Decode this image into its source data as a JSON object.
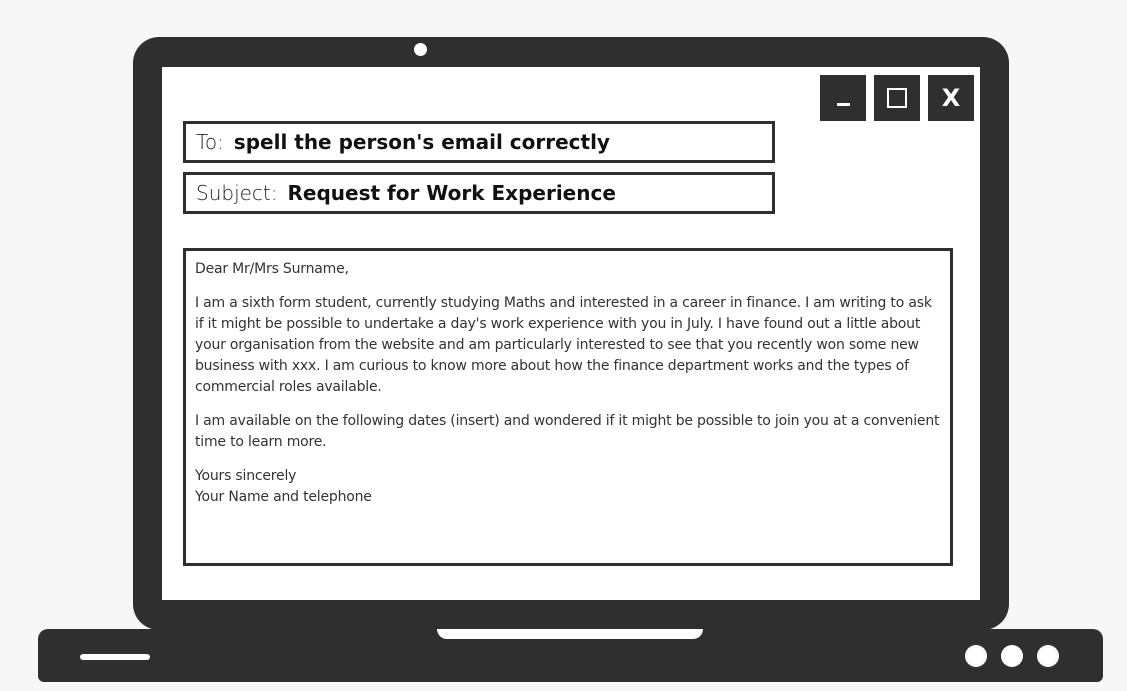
{
  "window_controls": {
    "minimize_icon": "minimize-icon",
    "maximize_icon": "maximize-icon",
    "close_label": "X"
  },
  "email": {
    "to_label": "To:",
    "to_value": "spell the person's email correctly",
    "subject_label": "Subject:",
    "subject_value": "Request for Work Experience",
    "body": {
      "greeting": "Dear Mr/Mrs Surname,",
      "paragraph1": "I am a sixth form student, currently studying Maths and interested in a career in finance.  I am writing to ask if it might be possible to undertake a day's work experience with you in July.  I have found out a little about your organisation from the website and am particularly interested to see that you recently won some new business with xxx.  I am curious to know more about how the finance department works and the types of commercial roles available.",
      "paragraph2": "I am available on the following dates (insert) and wondered if it might be possible to join you at a convenient time to learn more.",
      "closing": "Yours sincerely",
      "signature": "Your Name and telephone"
    }
  },
  "colors": {
    "frame": "#2f2f2f",
    "screen": "#ffffff",
    "background": "#f7f7f7"
  }
}
